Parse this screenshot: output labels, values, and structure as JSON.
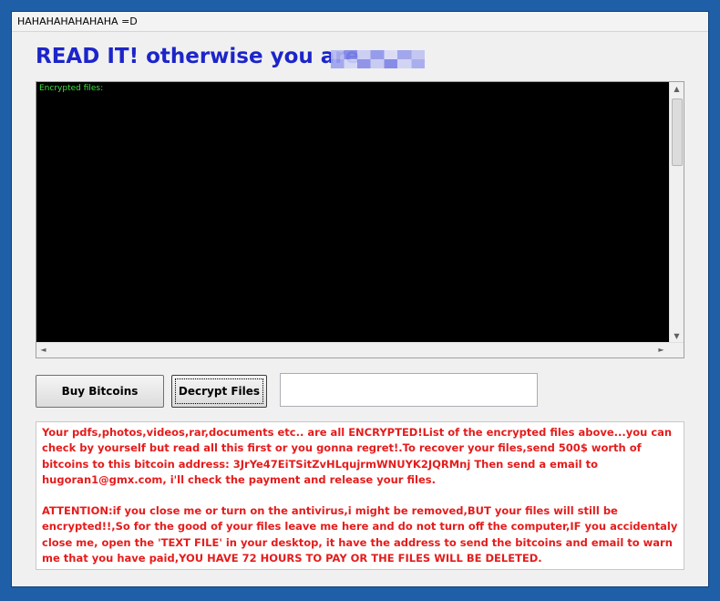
{
  "window": {
    "title": "HAHAHAHAHAHAHA =D"
  },
  "headline": "READ IT! otherwise you are",
  "console": {
    "label": "Encrypted files:"
  },
  "buttons": {
    "buy": "Buy Bitcoins",
    "decrypt": "Decrypt Files"
  },
  "code_input": {
    "value": ""
  },
  "message": {
    "paragraph1": "Your pdfs,photos,videos,rar,documents etc.. are all ENCRYPTED!List of the encrypted files above...you can check by yourself but read all this first or you gonna regret!.To recover your files,send 500$ worth of bitcoins to this bitcoin address: 3JrYe47EiTSitZvHLqujrmWNUYK2JQRMnj Then send a email to hugoran1@gmx.com, i'll check the payment and release your files.",
    "paragraph2": "ATTENTION:if you close me or turn on the antivirus,i might be removed,BUT your files will still be encrypted!!,So for the good of your files leave me here and do not turn off the computer,IF you accidentaly close me, open the 'TEXT FILE' in your desktop, it have the address to send the bitcoins and email to warn me that you have paid,YOU HAVE 72 HOURS TO PAY OR THE FILES WILL BE DELETED."
  },
  "colors": {
    "headline": "#1c25c9",
    "console_bg": "#000000",
    "console_text": "#3ee23e",
    "message_text": "#e51c1c",
    "desktop": "#1f5fa8"
  },
  "icons": {
    "scroll_up": "▲",
    "scroll_down": "▼",
    "scroll_left": "◄",
    "scroll_right": "►"
  }
}
